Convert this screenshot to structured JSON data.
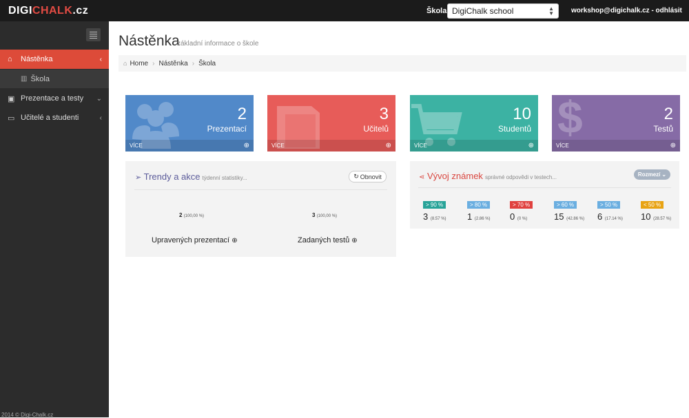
{
  "header": {
    "logo_part1": "DIGI",
    "logo_part2": "CHALK",
    "logo_part3": ".cz",
    "school_label": "Škola:",
    "school_value": "DigiChalk school",
    "user": "workshop@digichalk.cz - odhlásit"
  },
  "sidebar": {
    "items": [
      {
        "label": "Nástěnka",
        "icon": "home-icon"
      },
      {
        "label": "Škola",
        "icon": "bar-chart-icon"
      },
      {
        "label": "Prezentace a testy",
        "icon": "briefcase-icon"
      },
      {
        "label": "Učitelé a studenti",
        "icon": "folder-icon"
      }
    ],
    "footer": "2014 © Digi-Chalk.cz"
  },
  "page": {
    "title": "Nástěnka",
    "subtitle": "základní informace o škole"
  },
  "breadcrumb": [
    "Home",
    "Nástěnka",
    "Škola"
  ],
  "tiles": [
    {
      "value": "2",
      "label": "Prezentací",
      "more": "VÍCE",
      "color": "#5189c9",
      "icon": "users-icon"
    },
    {
      "value": "3",
      "label": "Učitelů",
      "more": "VÍCE",
      "color": "#e75c59",
      "icon": "book-icon"
    },
    {
      "value": "10",
      "label": "Studentů",
      "more": "VÍCE",
      "color": "#3cb2a3",
      "icon": "cart-icon"
    },
    {
      "value": "2",
      "label": "Testů",
      "more": "VÍCE",
      "color": "#866ba6",
      "icon": "dollar-icon"
    }
  ],
  "trends": {
    "title": "Trendy a akce",
    "subtitle": "týdenní statistiky...",
    "refresh": "Obnovit",
    "stats": [
      {
        "value": "2",
        "pct": "(100,00 %)",
        "label": "Upravených prezentací"
      },
      {
        "value": "3",
        "pct": "(100,00 %)",
        "label": "Zadaných testů"
      }
    ]
  },
  "grades": {
    "title": "Vývoj známek",
    "subtitle": "správné odpovědi v testech...",
    "range_button": "Rozmezí",
    "items": [
      {
        "badge": "> 90 %",
        "value": "3",
        "pct": "(8.57 %)",
        "color": "#27a398"
      },
      {
        "badge": "> 80 %",
        "value": "1",
        "pct": "(2.86 %)",
        "color": "#6aaee0"
      },
      {
        "badge": "> 70 %",
        "value": "0",
        "pct": "(0 %)",
        "color": "#e0413f"
      },
      {
        "badge": "> 60 %",
        "value": "15",
        "pct": "(42.86 %)",
        "color": "#6aaee0"
      },
      {
        "badge": "> 50 %",
        "value": "6",
        "pct": "(17.14 %)",
        "color": "#6aaee0"
      },
      {
        "badge": "< 50 %",
        "value": "10",
        "pct": "(28.57 %)",
        "color": "#e8a313"
      }
    ]
  }
}
